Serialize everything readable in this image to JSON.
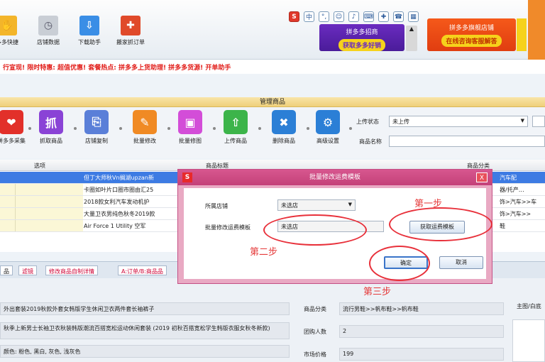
{
  "toolbar": {
    "items": [
      {
        "label": "多多快捷",
        "icon": "handshake-icon",
        "color": "#f3b52a"
      },
      {
        "label": "店铺数据",
        "icon": "clock-icon",
        "color": "#c9ced5"
      },
      {
        "label": "下载助手",
        "icon": "download-icon",
        "color": "#3a8ee6"
      },
      {
        "label": "搬家抓订单",
        "icon": "gift-icon",
        "color": "#e04a2a"
      }
    ]
  },
  "sys_icons": [
    "S",
    "中",
    "°,",
    "☺",
    "♪",
    "⌨",
    "✚",
    "☎",
    "▦"
  ],
  "banners": {
    "left": {
      "title": "拼多多招商",
      "button": "获取多多好销"
    },
    "right": {
      "title": "拼多多旗舰店铺",
      "button": "在线咨询客服解答"
    }
  },
  "notice": "行宣现! 限时特惠: 超值优惠! 套餐热点: 拼多多上货助理! 拼多多货源! 开单助手",
  "manage": {
    "header": "管理商品",
    "tools": [
      {
        "label": "拼多多采集",
        "icon": "heart-icon",
        "glyph": "❤",
        "color": "#e2302a"
      },
      {
        "label": "抓取商品",
        "icon": "grab-icon",
        "glyph": "抓",
        "color": "#8a43d6"
      },
      {
        "label": "店铺复制",
        "icon": "copy-icon",
        "glyph": "⎘",
        "color": "#5a7fd8"
      },
      {
        "label": "批量修改",
        "icon": "pencil-icon",
        "glyph": "✎",
        "color": "#f08a24"
      },
      {
        "label": "批量修图",
        "icon": "image-edit-icon",
        "glyph": "▣",
        "color": "#d34dd8"
      },
      {
        "label": "上传商品",
        "icon": "upload-icon",
        "glyph": "⇧",
        "color": "#3cb44a"
      },
      {
        "label": "删除商品",
        "icon": "trash-icon",
        "glyph": "🗑",
        "color": "#2b7fd6"
      },
      {
        "label": "高级设置",
        "icon": "gear-icon",
        "glyph": "⚙",
        "color": "#2b7fd6"
      }
    ],
    "status_label": "上传状态",
    "status_value": "未上传",
    "title_label": "商品名称"
  },
  "table": {
    "columns": [
      "选项",
      "商品标题",
      "商品分类"
    ],
    "rows": [
      {
        "title": "但丁大师秋Vn搁湖upzan新",
        "category": "汽车配",
        "selected": true
      },
      {
        "title": "卡圈如叶片口圈市圈由汇25",
        "category": "器/托产…"
      },
      {
        "title": "2018款女利汽车发动机护",
        "category": "饰>汽车>>车"
      },
      {
        "title": "大量卫衣男纯色秋冬2019款",
        "category": "饰>汽车>>"
      },
      {
        "title": "Air Force 1 Utility 空军",
        "category": "鞋"
      }
    ]
  },
  "detail_tabs": [
    {
      "label": "品",
      "color": "#222"
    },
    {
      "label": "滤镜",
      "color": "#c03"
    },
    {
      "label": "修改商品自制详情",
      "color": "#c03"
    },
    {
      "label": "A:订单/B:商品品",
      "color": "#c03"
    }
  ],
  "detail": {
    "title_value": "外出套装2019秋款外套女韩版学生休闲卫衣两件套长袖裤子",
    "desc_value": "秋季上新男士长袖卫衣秋装韩版潮流百搭宽松运动休闲套装 (2019 初秋百搭宽松学生韩版衣服女秋冬新款)",
    "sku_value": "颜色: 粉色, 黑白, 灰色, 浅灰色",
    "category_label": "商品分类",
    "category_value": "流行男鞋>>帆布鞋>>帆布鞋",
    "group_label": "团购人数",
    "group_value": "2",
    "market_label": "市场价格",
    "market_value": "199",
    "side_label": "主图/白底"
  },
  "dialog": {
    "title": "批量修改运费模板",
    "logo": "S",
    "close": "X",
    "shop_label": "所属店铺",
    "shop_value": "未选店",
    "template_label": "批量修改运费模板",
    "template_value": "未选店",
    "fetch_button": "获取运费模板",
    "ok_button": "确定",
    "cancel_button": "取消"
  },
  "annotations": {
    "step1": "第一步",
    "step2": "第二步",
    "step3": "第三步"
  }
}
